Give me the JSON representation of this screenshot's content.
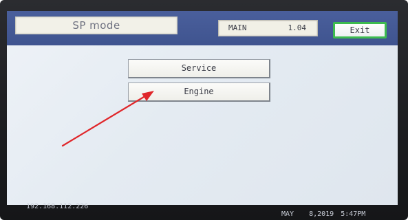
{
  "header": {
    "mode_title": "SP mode",
    "version_label": "MAIN",
    "version_value": "1.04",
    "exit_label": "Exit"
  },
  "menu": {
    "items": [
      {
        "label": "Service"
      },
      {
        "label": "Engine"
      }
    ]
  },
  "footer": {
    "ip_address": "192.168.112.226",
    "date_month": "MAY",
    "date_day_year": "8,2019",
    "time": "5:47PM"
  },
  "colors": {
    "header_bar": "#3f548f",
    "screen_background": "#e4ebf2",
    "exit_border": "#3dbb4f",
    "annotation_arrow": "#e0262a"
  },
  "annotation": {
    "type": "arrow",
    "target": "menu-button-engine"
  }
}
